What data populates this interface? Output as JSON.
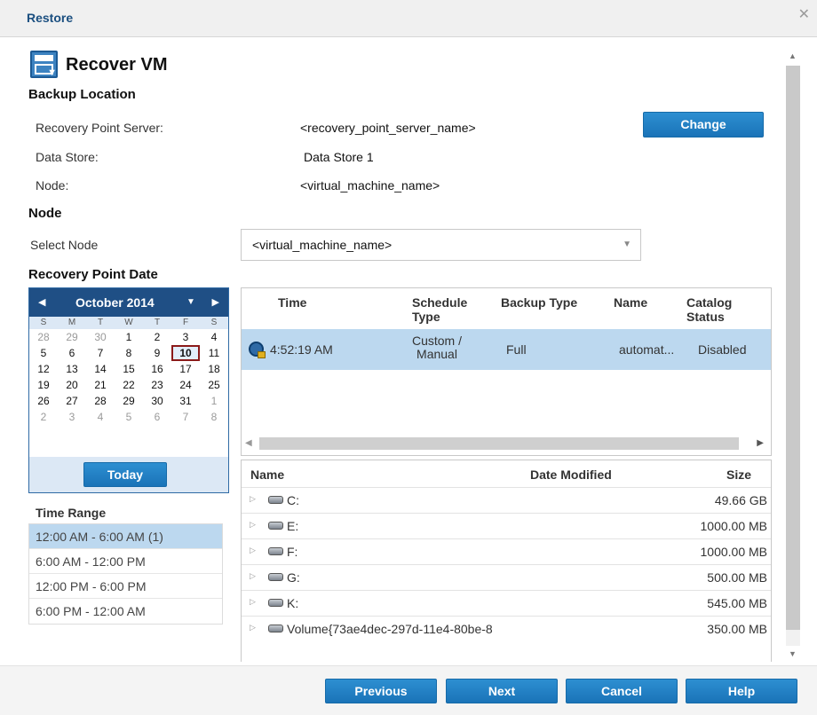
{
  "dialog": {
    "title": "Restore",
    "close_glyph": "✕"
  },
  "header": {
    "title": "Recover VM",
    "icon": "recover-vm-icon"
  },
  "backup_location": {
    "heading": "Backup Location",
    "rps_label": "Recovery Point Server:",
    "rps_value": "<recovery_point_server_name>",
    "datastore_label": "Data Store:",
    "datastore_value": "Data Store 1",
    "node_label": "Node:",
    "node_value": "<virtual_machine_name>",
    "change_button": "Change"
  },
  "node": {
    "heading": "Node",
    "select_label": "Select Node",
    "selected": "<virtual_machine_name>"
  },
  "recovery_point_date": {
    "heading": "Recovery Point Date",
    "month": "October 2014",
    "days_of_week": [
      "S",
      "M",
      "T",
      "W",
      "T",
      "F",
      "S"
    ],
    "weeks": [
      [
        "28",
        "29",
        "30",
        "1",
        "2",
        "3",
        "4"
      ],
      [
        "5",
        "6",
        "7",
        "8",
        "9",
        "10",
        "11"
      ],
      [
        "12",
        "13",
        "14",
        "15",
        "16",
        "17",
        "18"
      ],
      [
        "19",
        "20",
        "21",
        "22",
        "23",
        "24",
        "25"
      ],
      [
        "26",
        "27",
        "28",
        "29",
        "30",
        "31",
        "1"
      ],
      [
        "2",
        "3",
        "4",
        "5",
        "6",
        "7",
        "8"
      ]
    ],
    "selected_day": "10",
    "today_button": "Today"
  },
  "time_range": {
    "heading": "Time Range",
    "items": [
      {
        "label": "12:00 AM - 6:00 AM  (1)",
        "active": true
      },
      {
        "label": "6:00 AM - 12:00 PM",
        "active": false
      },
      {
        "label": "12:00 PM - 6:00 PM",
        "active": false
      },
      {
        "label": "6:00 PM - 12:00 AM",
        "active": false
      }
    ]
  },
  "recovery_points": {
    "columns": {
      "time": "Time",
      "schedule_type_1": "Schedule",
      "schedule_type_2": "Type",
      "backup_type": "Backup Type",
      "name": "Name",
      "catalog_status_1": "Catalog",
      "catalog_status_2": "Status"
    },
    "rows": [
      {
        "time": "4:52:19 AM",
        "schedule_type_1": "Custom /",
        "schedule_type_2": "Manual",
        "backup_type": "Full",
        "name": "automat...",
        "catalog_status": "Disabled"
      }
    ]
  },
  "files": {
    "columns": {
      "name": "Name",
      "date_modified": "Date Modified",
      "size": "Size"
    },
    "rows": [
      {
        "name": "C:",
        "size": "49.66 GB"
      },
      {
        "name": "E:",
        "size": "1000.00 MB"
      },
      {
        "name": "F:",
        "size": "1000.00 MB"
      },
      {
        "name": "G:",
        "size": "500.00 MB"
      },
      {
        "name": "K:",
        "size": "545.00 MB"
      },
      {
        "name": "Volume{73ae4dec-297d-11e4-80be-8",
        "size": "350.00 MB"
      }
    ]
  },
  "footer": {
    "previous": "Previous",
    "next": "Next",
    "cancel": "Cancel",
    "help": "Help"
  }
}
